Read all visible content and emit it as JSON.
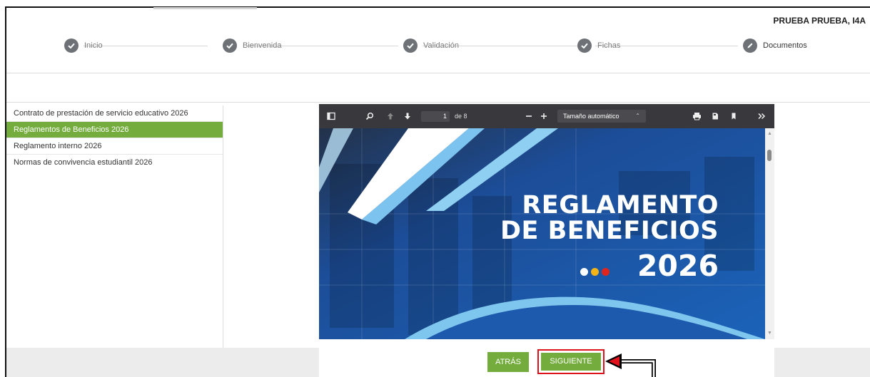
{
  "header": {
    "user_name": "PRUEBA PRUEBA, I4A"
  },
  "steps": [
    {
      "label": "Inicio",
      "state": "done",
      "icon": "check-icon"
    },
    {
      "label": "Bienvenida",
      "state": "done",
      "icon": "check-icon"
    },
    {
      "label": "Validación",
      "state": "done",
      "icon": "check-icon"
    },
    {
      "label": "Fichas",
      "state": "done",
      "icon": "check-icon"
    },
    {
      "label": "Documentos",
      "state": "current",
      "icon": "pencil-icon"
    }
  ],
  "documents": [
    {
      "label": "Contrato de prestación de servicio educativo 2026",
      "active": false
    },
    {
      "label": "Reglamentos de Beneficios 2026",
      "active": true
    },
    {
      "label": "Reglamento interno 2026",
      "active": false
    },
    {
      "label": "Normas de convivencia estudiantil 2026",
      "active": false
    }
  ],
  "viewer": {
    "page_current": "1",
    "page_of": "de 8",
    "zoom_label": "Tamaño automático",
    "cover_title_line1": "REGLAMENTO",
    "cover_title_line2": "DE BENEFICIOS",
    "cover_year": "2026"
  },
  "actions": {
    "back_label": "ATRÁS",
    "next_label": "SIGUIENTE"
  },
  "colors": {
    "accent_green": "#74ad3e",
    "highlight_red": "#e0121b",
    "toolbar_dark": "#38383d",
    "cover_blue": "#1d59ac"
  }
}
